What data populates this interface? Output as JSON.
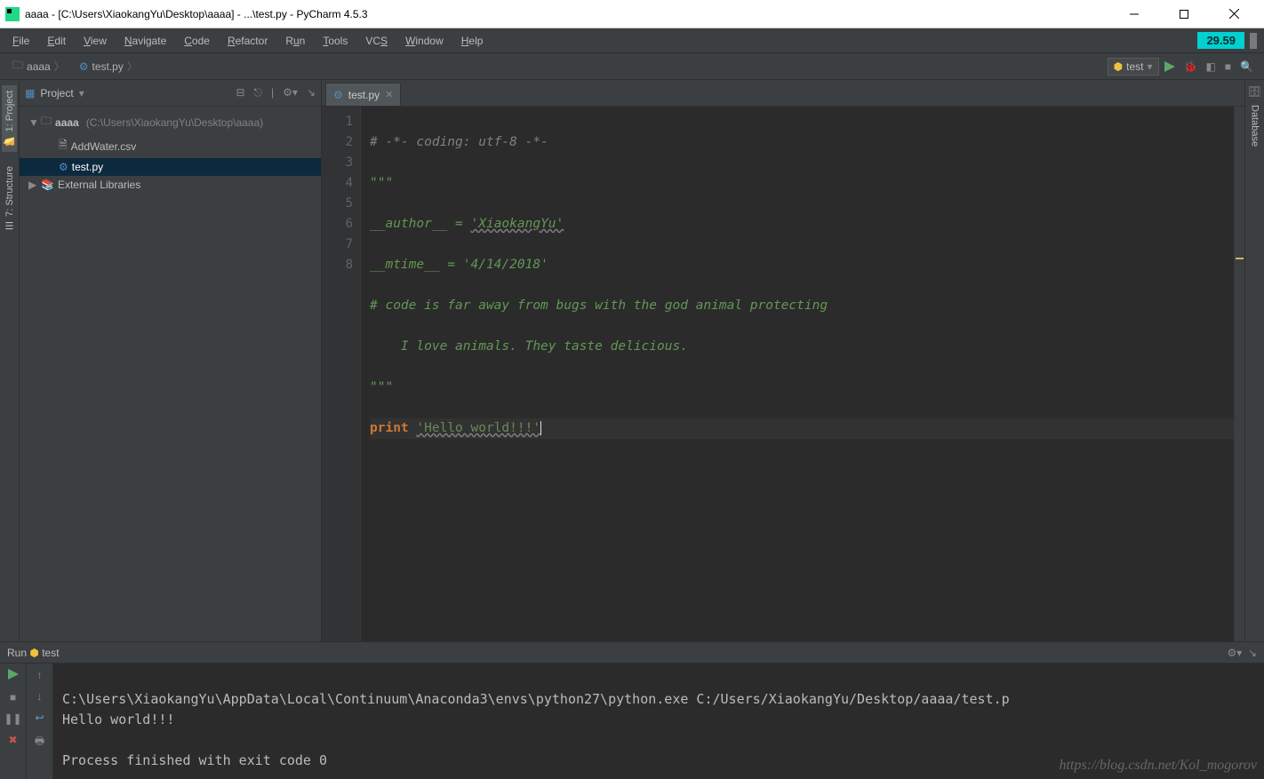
{
  "window": {
    "title": "aaaa - [C:\\Users\\XiaokangYu\\Desktop\\aaaa] - ...\\test.py - PyCharm 4.5.3"
  },
  "menu": {
    "items": [
      "File",
      "Edit",
      "View",
      "Navigate",
      "Code",
      "Refactor",
      "Run",
      "Tools",
      "VCS",
      "Window",
      "Help"
    ],
    "badge": "29.59"
  },
  "breadcrumbs": {
    "root": "aaaa",
    "file": "test.py"
  },
  "toolbar": {
    "run_config": "test"
  },
  "left_tool": {
    "project": "1: Project",
    "structure": "7: Structure"
  },
  "right_tool": {
    "database": "Database"
  },
  "project_panel": {
    "header": "Project",
    "root": "aaaa",
    "root_path": "(C:\\Users\\XiaokangYu\\Desktop\\aaaa)",
    "items": [
      "AddWater.csv",
      "test.py"
    ],
    "external": "External Libraries"
  },
  "editor": {
    "tab": "test.py",
    "lines": [
      "1",
      "2",
      "3",
      "4",
      "5",
      "6",
      "7",
      "8"
    ],
    "code": {
      "l1": "# -*- coding: utf-8 -*-",
      "l2": "\"\"\"",
      "l3a": "__author__ = ",
      "l3b": "'XiaokangYu'",
      "l4a": "__mtime__ = ",
      "l4b": "'4/14/2018'",
      "l5": "# code is far away from bugs with the god animal protecting",
      "l6": "    I love animals. They taste delicious.",
      "l7": "\"\"\"",
      "l8_kw": "print",
      "l8_sp": " ",
      "l8_str": "'Hello world!!!'"
    }
  },
  "run_panel": {
    "header": "Run",
    "header_file": "test",
    "console": {
      "l1": "C:\\Users\\XiaokangYu\\AppData\\Local\\Continuum\\Anaconda3\\envs\\python27\\python.exe C:/Users/XiaokangYu/Desktop/aaaa/test.p",
      "l2": "Hello world!!!",
      "l3": "",
      "l4": "Process finished with exit code 0"
    }
  },
  "watermark": "https://blog.csdn.net/Kol_mogorov"
}
